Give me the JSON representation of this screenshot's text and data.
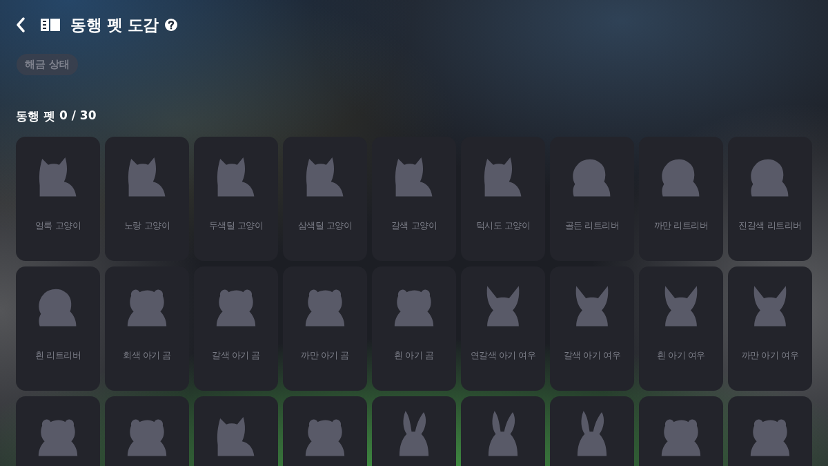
{
  "header": {
    "title": "동행 펫 도감"
  },
  "filter_chip": {
    "label": "해금 상태"
  },
  "section": {
    "label": "동행 펫",
    "count": "0 / 30"
  },
  "pets": [
    {
      "kind": "cat",
      "name": "얼룩 고양이"
    },
    {
      "kind": "cat",
      "name": "노랑 고양이"
    },
    {
      "kind": "cat",
      "name": "두색털 고양이"
    },
    {
      "kind": "cat",
      "name": "삼색털 고양이"
    },
    {
      "kind": "cat",
      "name": "갈색 고양이"
    },
    {
      "kind": "cat",
      "name": "턱시도 고양이"
    },
    {
      "kind": "dog",
      "name": "골든 리트리버"
    },
    {
      "kind": "dog",
      "name": "까만 리트리버"
    },
    {
      "kind": "dog",
      "name": "진갈색 리트리버"
    },
    {
      "kind": "dog",
      "name": "흰 리트리버"
    },
    {
      "kind": "bear",
      "name": "회색 아기 곰"
    },
    {
      "kind": "bear",
      "name": "갈색 아기 곰"
    },
    {
      "kind": "bear",
      "name": "까만 아기 곰"
    },
    {
      "kind": "bear",
      "name": "흰 아기 곰"
    },
    {
      "kind": "fox",
      "name": "연갈색 아기 여우"
    },
    {
      "kind": "fox",
      "name": "갈색 아기 여우"
    },
    {
      "kind": "fox",
      "name": "흰 아기 여우"
    },
    {
      "kind": "fox",
      "name": "까만 아기 여우"
    },
    {
      "kind": "bear"
    },
    {
      "kind": "bear"
    },
    {
      "kind": "cat"
    },
    {
      "kind": "bear"
    },
    {
      "kind": "rabbit"
    },
    {
      "kind": "rabbit"
    },
    {
      "kind": "rabbit"
    },
    {
      "kind": "bear"
    },
    {
      "kind": "bear"
    }
  ]
}
